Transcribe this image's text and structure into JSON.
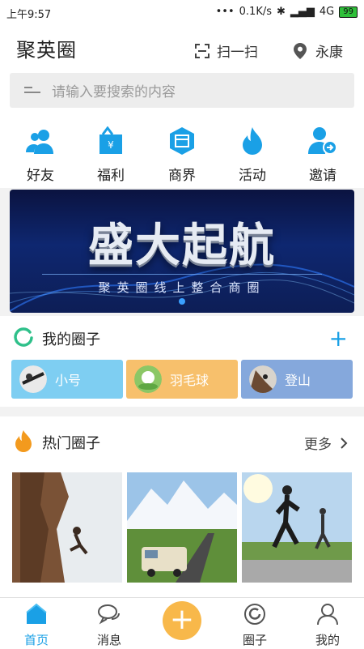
{
  "status_bar": {
    "time": "上午9:57",
    "speed": "0.1K/s",
    "network": "4G",
    "battery": "99"
  },
  "header": {
    "logo": "聚英圈",
    "scan_label": "扫一扫",
    "location_label": "永康"
  },
  "search": {
    "placeholder": "请输入要搜索的内容"
  },
  "categories": [
    {
      "label": "好友",
      "icon": "friends-icon"
    },
    {
      "label": "福利",
      "icon": "gift-bag-icon"
    },
    {
      "label": "商界",
      "icon": "shop-icon"
    },
    {
      "label": "活动",
      "icon": "flame-icon"
    },
    {
      "label": "邀请",
      "icon": "invite-user-icon"
    }
  ],
  "banner": {
    "title": "盛大起航",
    "subtitle": "聚英圈线上整合商圈"
  },
  "my_circles": {
    "title": "我的圈子",
    "add_label": "+",
    "items": [
      {
        "name": "小号",
        "color": "#7ecef2"
      },
      {
        "name": "羽毛球",
        "color": "#f7c06c"
      },
      {
        "name": "登山",
        "color": "#85a8dc"
      }
    ]
  },
  "hot_circles": {
    "title": "热门圈子",
    "more_label": "更多"
  },
  "tabbar": {
    "items": [
      {
        "label": "首页",
        "active": true
      },
      {
        "label": "消息",
        "active": false
      },
      {
        "label": "圈子",
        "active": false
      },
      {
        "label": "我的",
        "active": false
      }
    ],
    "fab_label": "+"
  },
  "colors": {
    "accent": "#1aa0e6",
    "fab": "#f8b84a"
  }
}
